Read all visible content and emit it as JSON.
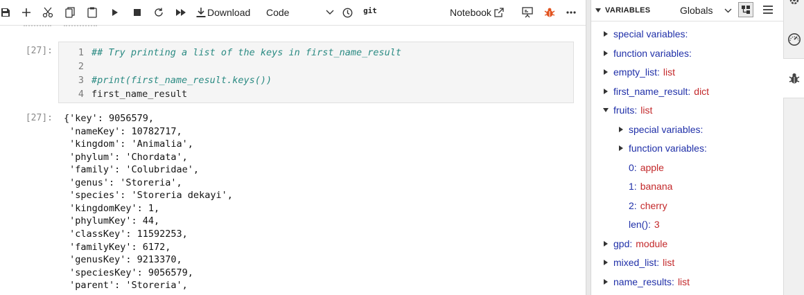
{
  "toolbar": {
    "download_label": "Download",
    "cell_type": "Code",
    "git_label": "git",
    "notebook_label": "Notebook"
  },
  "cell_in": {
    "prompt": "[27]:",
    "lines": [
      {
        "num": "1",
        "text": "## Try printing a list of the keys in first_name_result",
        "kind": "comment"
      },
      {
        "num": "2",
        "text": "",
        "kind": "code"
      },
      {
        "num": "3",
        "text": "#print(first_name_result.keys())",
        "kind": "comment"
      },
      {
        "num": "4",
        "text": "first_name_result",
        "kind": "code"
      }
    ]
  },
  "cell_out": {
    "prompt": "[27]:",
    "lines": [
      "{'key': 9056579,",
      " 'nameKey': 10782717,",
      " 'kingdom': 'Animalia',",
      " 'phylum': 'Chordata',",
      " 'family': 'Colubridae',",
      " 'genus': 'Storeria',",
      " 'species': 'Storeria dekayi',",
      " 'kingdomKey': 1,",
      " 'phylumKey': 44,",
      " 'classKey': 11592253,",
      " 'familyKey': 6172,",
      " 'genusKey': 9213370,",
      " 'speciesKey': 9056579,",
      " 'parent': 'Storeria',"
    ]
  },
  "variables": {
    "title": "VARIABLES",
    "scope": "Globals",
    "items": [
      {
        "name": "special variables",
        "value": "",
        "expanded": false,
        "depth": 0,
        "arrow": true
      },
      {
        "name": "function variables",
        "value": "",
        "expanded": false,
        "depth": 0,
        "arrow": true
      },
      {
        "name": "empty_list",
        "value": "list",
        "expanded": false,
        "depth": 0,
        "arrow": true
      },
      {
        "name": "first_name_result",
        "value": "dict",
        "expanded": false,
        "depth": 0,
        "arrow": true
      },
      {
        "name": "fruits",
        "value": "list",
        "expanded": true,
        "depth": 0,
        "arrow": true
      },
      {
        "name": "special variables",
        "value": "",
        "expanded": false,
        "depth": 1,
        "arrow": true
      },
      {
        "name": "function variables",
        "value": "",
        "expanded": false,
        "depth": 1,
        "arrow": true
      },
      {
        "name": "0",
        "value": "apple",
        "expanded": false,
        "depth": 1,
        "arrow": false
      },
      {
        "name": "1",
        "value": "banana",
        "expanded": false,
        "depth": 1,
        "arrow": false
      },
      {
        "name": "2",
        "value": "cherry",
        "expanded": false,
        "depth": 1,
        "arrow": false
      },
      {
        "name": "len()",
        "value": "3",
        "expanded": false,
        "depth": 1,
        "arrow": false
      },
      {
        "name": "gpd",
        "value": "module",
        "expanded": false,
        "depth": 0,
        "arrow": true
      },
      {
        "name": "mixed_list",
        "value": "list",
        "expanded": false,
        "depth": 0,
        "arrow": true
      },
      {
        "name": "name_results",
        "value": "list",
        "expanded": false,
        "depth": 0,
        "arrow": true
      }
    ]
  },
  "colors": {
    "accent_blue": "#1f2fa8",
    "value_red": "#c3282a",
    "comment_teal": "#2a8a82",
    "debug_orange": "#e2531f"
  }
}
